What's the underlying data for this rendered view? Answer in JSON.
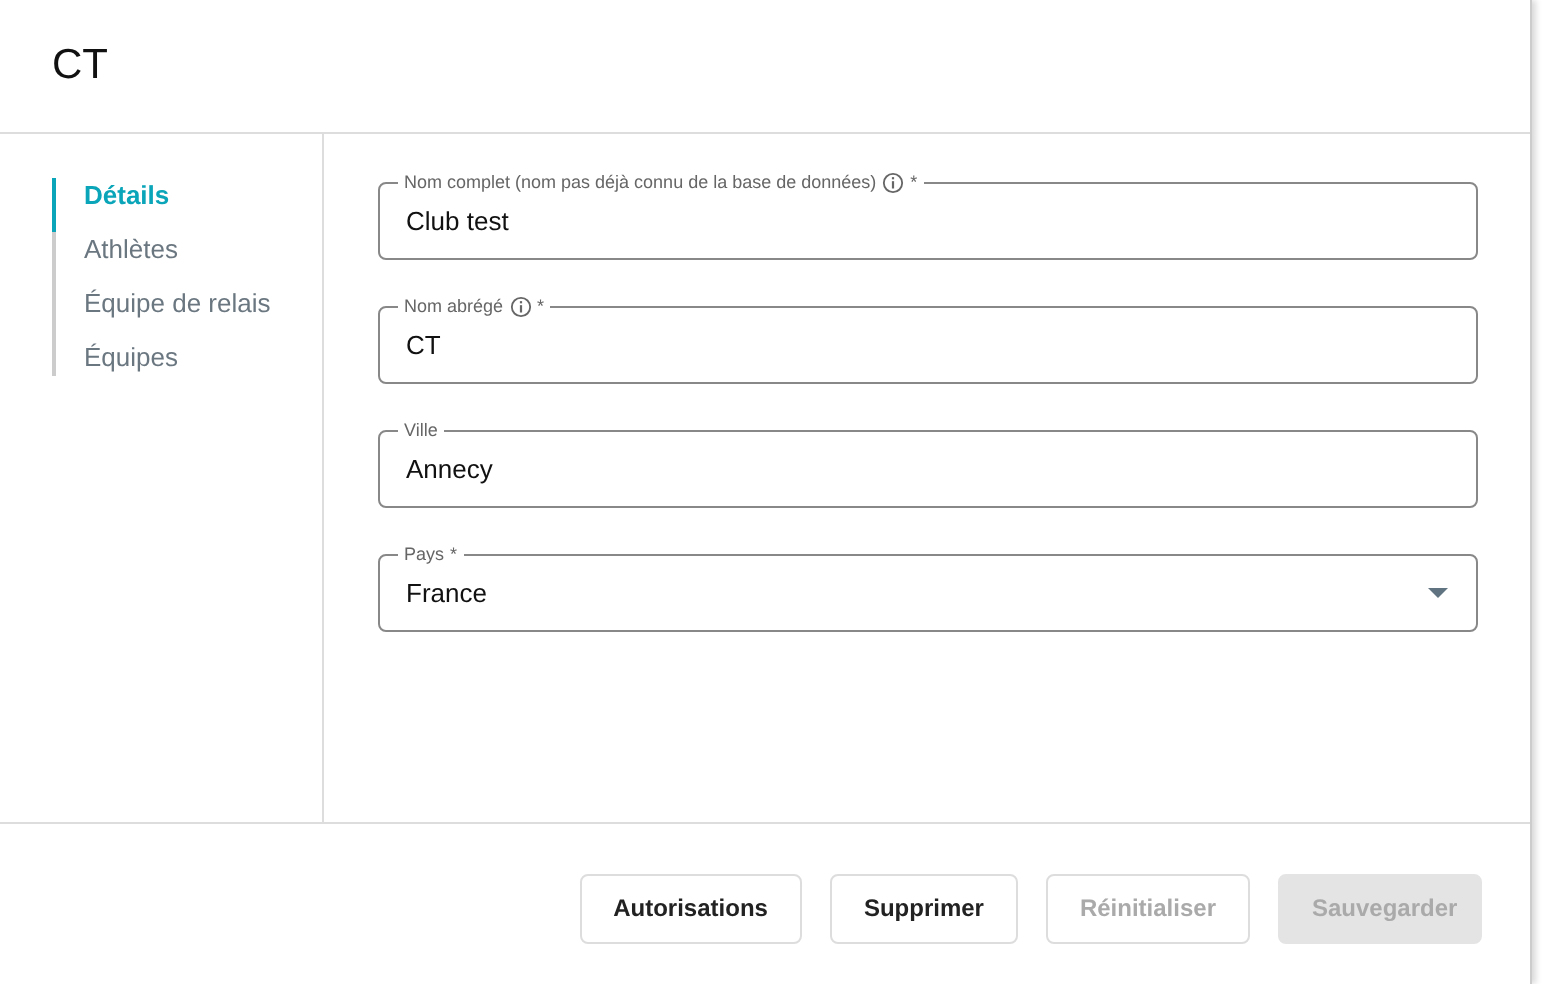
{
  "dialog": {
    "title": "CT"
  },
  "sidebar": {
    "items": [
      {
        "label": "Détails",
        "selected": true
      },
      {
        "label": "Athlètes",
        "selected": false
      },
      {
        "label": "Équipe de relais",
        "selected": false
      },
      {
        "label": "Équipes",
        "selected": false
      }
    ]
  },
  "fields": [
    {
      "kind": "text",
      "label": "Nom complet (nom pas déjà connu de la base de données)",
      "info": true,
      "required_mark": "*",
      "value": "Club test"
    },
    {
      "kind": "text",
      "label": "Nom abrégé",
      "info": true,
      "required_mark": "*",
      "value": "CT"
    },
    {
      "kind": "text",
      "label": "Ville",
      "value": "Annecy"
    },
    {
      "kind": "select",
      "label": "Pays",
      "required_mark": "*",
      "value": "France"
    }
  ],
  "buttons": [
    {
      "label": "Autorisations",
      "kind": "outline",
      "disabled": false
    },
    {
      "label": "Supprimer",
      "kind": "outline",
      "disabled": false
    },
    {
      "label": "Réinitialiser",
      "kind": "outline",
      "disabled": true
    },
    {
      "label": "Sauvegarder",
      "kind": "filled",
      "disabled": true
    }
  ]
}
